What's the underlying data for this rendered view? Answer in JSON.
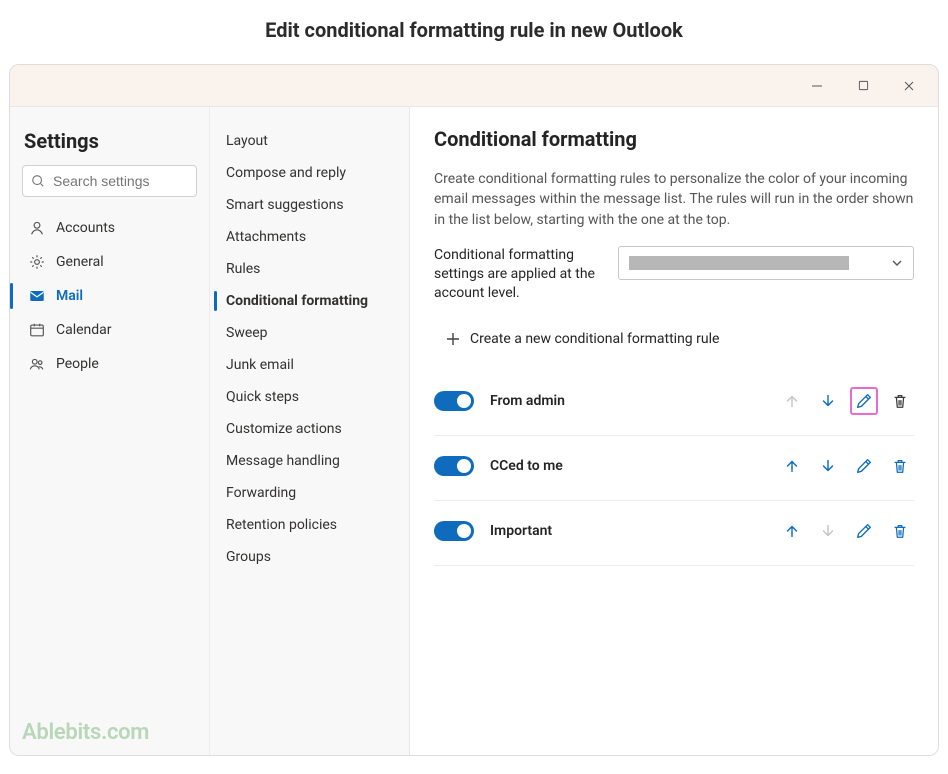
{
  "page_title": "Edit conditional formatting rule in new Outlook",
  "settings_header": "Settings",
  "search": {
    "placeholder": "Search settings"
  },
  "nav": {
    "items": [
      {
        "label": "Accounts"
      },
      {
        "label": "General"
      },
      {
        "label": "Mail"
      },
      {
        "label": "Calendar"
      },
      {
        "label": "People"
      }
    ]
  },
  "sub": {
    "items": [
      {
        "label": "Layout"
      },
      {
        "label": "Compose and reply"
      },
      {
        "label": "Smart suggestions"
      },
      {
        "label": "Attachments"
      },
      {
        "label": "Rules"
      },
      {
        "label": "Conditional formatting"
      },
      {
        "label": "Sweep"
      },
      {
        "label": "Junk email"
      },
      {
        "label": "Quick steps"
      },
      {
        "label": "Customize actions"
      },
      {
        "label": "Message handling"
      },
      {
        "label": "Forwarding"
      },
      {
        "label": "Retention policies"
      },
      {
        "label": "Groups"
      }
    ]
  },
  "main": {
    "title": "Conditional formatting",
    "intro": "Create conditional formatting rules to personalize the color of your incoming email messages within the message list. The rules will run in the order shown in the list below, starting with the one at the top.",
    "applied_text": "Conditional formatting settings are applied at the account level.",
    "create_label": "Create a new conditional formatting rule",
    "rules": [
      {
        "name": "From admin"
      },
      {
        "name": "CCed to me"
      },
      {
        "name": "Important"
      }
    ]
  },
  "watermark": "Ablebits.com"
}
